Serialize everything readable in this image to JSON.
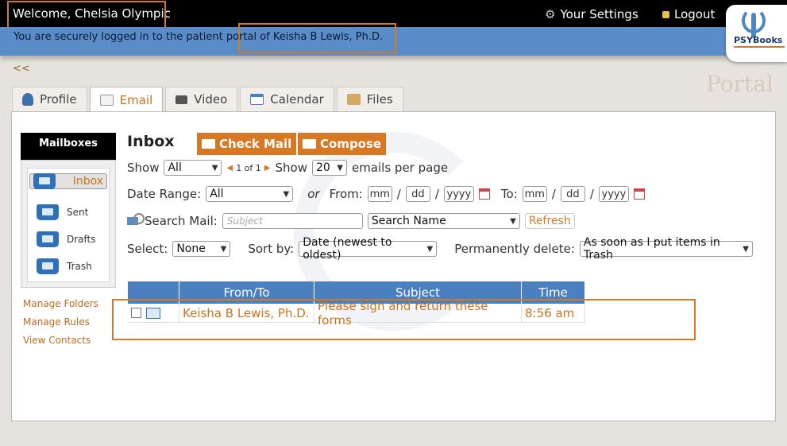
{
  "header": {
    "welcome": "Welcome, Chelsia Olympic",
    "settings_label": "Your Settings",
    "logout_label": "Logout",
    "secure_message": "You are securely logged in to the patient portal of Keisha B Lewis, Ph.D.",
    "logo_text": "PSYBooks",
    "portal_watermark": "Portal",
    "back_link": "<<",
    "accent_color": "#d67824",
    "header_blue": "#5a8dc8"
  },
  "tabs": [
    {
      "label": "Profile",
      "icon": "person-icon"
    },
    {
      "label": "Email",
      "icon": "envelope-icon",
      "active": true
    },
    {
      "label": "Video",
      "icon": "camera-icon"
    },
    {
      "label": "Calendar",
      "icon": "calendar-icon"
    },
    {
      "label": "Files",
      "icon": "folder-icon"
    }
  ],
  "sidebar": {
    "title": "Mailboxes",
    "items": [
      {
        "label": "Inbox",
        "icon": "inbox-folder-icon",
        "selected": true
      },
      {
        "label": "Sent",
        "icon": "sent-folder-icon"
      },
      {
        "label": "Drafts",
        "icon": "drafts-folder-icon"
      },
      {
        "label": "Trash",
        "icon": "trash-folder-icon"
      }
    ],
    "links": [
      "Manage Folders",
      "Manage Rules",
      "View Contacts"
    ]
  },
  "main": {
    "title": "Inbox",
    "check_mail_label": "Check Mail",
    "compose_label": "Compose",
    "show_label": "Show",
    "show_filter": "All",
    "pager_text": "1 of 1",
    "show_label_2": "Show",
    "per_page": "20",
    "per_page_suffix": "emails per page",
    "date_range_label": "Date Range:",
    "date_range_value": "All",
    "or_label": "or",
    "from_label": "From:",
    "to_label": "To:",
    "date_placeholders": {
      "mm": "mm",
      "dd": "dd",
      "yyyy": "yyyy"
    },
    "date_sep": "/",
    "search_label": "Search Mail:",
    "search_placeholder": "Subject",
    "search_scope": "Search Name",
    "refresh_label": "Refresh",
    "select_label": "Select:",
    "select_value": "None",
    "sort_label": "Sort by:",
    "sort_value": "Date (newest to oldest)",
    "delete_label": "Permanently delete:",
    "delete_value": "As soon as I put items in Trash"
  },
  "table": {
    "headers": [
      "",
      "From/To",
      "Subject",
      "Time"
    ],
    "rows": [
      {
        "from": "Keisha B Lewis, Ph.D.",
        "subject": "Please sign and return these forms",
        "time": "8:56 am"
      }
    ]
  }
}
